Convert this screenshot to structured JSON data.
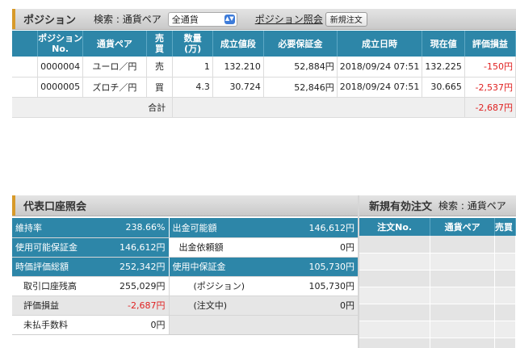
{
  "position": {
    "title": "ポジション",
    "search_label": "検索 : 通貨ペア",
    "currency_select": "全通貨",
    "inquiry_link": "ポジション照会",
    "new_order_button": "新規注文",
    "columns": [
      "ポジション\nNo.",
      "通貨ペア",
      "売\n買",
      "数量\n(万)",
      "成立値段",
      "必要保証金",
      "成立日時",
      "現在値",
      "評価損益"
    ],
    "rows": [
      {
        "no": "0000004",
        "pair": "ユーロ／円",
        "side": "売",
        "qty": "1",
        "price": "132.210",
        "margin": "52,884円",
        "datetime": "2018/09/24 07:51",
        "current": "132.225",
        "pl": "-150円"
      },
      {
        "no": "0000005",
        "pair": "ズロチ／円",
        "side": "買",
        "qty": "4.3",
        "price": "30.724",
        "margin": "52,846円",
        "datetime": "2018/09/24 07:51",
        "current": "30.665",
        "pl": "-2,537円"
      }
    ],
    "total_label": "合計",
    "total_pl": "-2,687円"
  },
  "account": {
    "title": "代表口座照会",
    "left": [
      {
        "label": "維持率",
        "value": "238.66%"
      },
      {
        "label": "使用可能保証金",
        "value": "146,612円"
      },
      {
        "label": "時価評価総額",
        "value": "252,342円"
      },
      {
        "label": "取引口座残高",
        "value": "255,029円"
      },
      {
        "label": "評価損益",
        "value": "-2,687円"
      },
      {
        "label": "未払手数料",
        "value": "0円"
      }
    ],
    "right": [
      {
        "label": "出金可能額",
        "value": "146,612円"
      },
      {
        "label": "出金依頼額",
        "value": "0円"
      },
      {
        "label": "使用中保証金",
        "value": "105,730円"
      },
      {
        "label": "(ポジション)",
        "value": "105,730円"
      },
      {
        "label": "(注文中)",
        "value": "0円"
      },
      {
        "label": "",
        "value": ""
      }
    ]
  },
  "orders": {
    "title": "新規有効注文",
    "search_label": "検索 : 通貨ペア",
    "columns": [
      "注文No.",
      "通貨ペア",
      "売買"
    ]
  },
  "colors": {
    "accent": "#d89a2a",
    "header_blue": "#2d86a8",
    "negative": "#e02020"
  }
}
